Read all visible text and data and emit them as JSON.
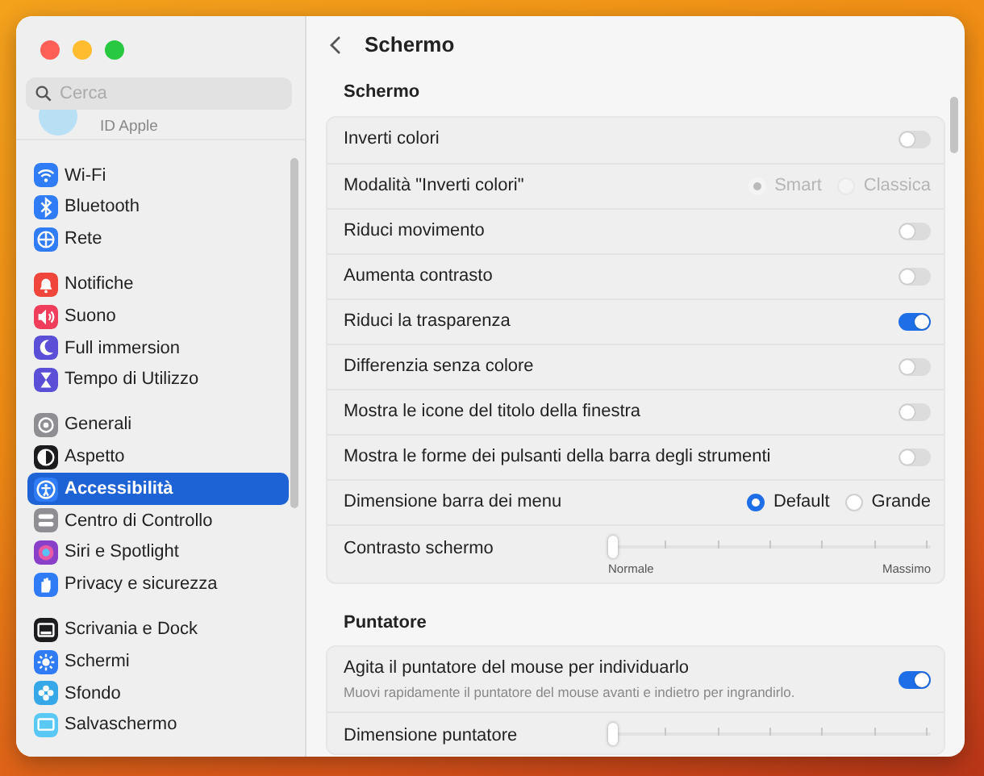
{
  "window": {
    "title": "Schermo"
  },
  "search": {
    "placeholder": "Cerca"
  },
  "account": {
    "label": "ID Apple"
  },
  "sidebar": {
    "groups": [
      [
        {
          "label": "Wi-Fi",
          "kind": "wifi",
          "color": "#2f7cf6",
          "selected": false
        },
        {
          "label": "Bluetooth",
          "kind": "bluetooth",
          "color": "#2f7cf6",
          "selected": false
        },
        {
          "label": "Rete",
          "kind": "globe",
          "color": "#2f7cf6",
          "selected": false
        }
      ],
      [
        {
          "label": "Notifiche",
          "kind": "bell",
          "color": "#f0453a",
          "selected": false
        },
        {
          "label": "Suono",
          "kind": "speaker",
          "color": "#ef3d5b",
          "selected": false
        },
        {
          "label": "Full immersion",
          "kind": "moon",
          "color": "#5a4fd6",
          "selected": false
        },
        {
          "label": "Tempo di Utilizzo",
          "kind": "hourglass",
          "color": "#5a4fd6",
          "selected": false
        }
      ],
      [
        {
          "label": "Generali",
          "kind": "gear",
          "color": "#8e8e93",
          "selected": false
        },
        {
          "label": "Aspetto",
          "kind": "contrast",
          "color": "#1c1c1e",
          "selected": false
        },
        {
          "label": "Accessibilità",
          "kind": "person",
          "color": "#2f7cf6",
          "selected": true
        },
        {
          "label": "Centro di Controllo",
          "kind": "switches",
          "color": "#8e8e93",
          "selected": false
        },
        {
          "label": "Siri e Spotlight",
          "kind": "orb",
          "color": "#8a3fc9",
          "selected": false
        },
        {
          "label": "Privacy e sicurezza",
          "kind": "hand",
          "color": "#2f7cf6",
          "selected": false
        }
      ],
      [
        {
          "label": "Scrivania e Dock",
          "kind": "dock",
          "color": "#1c1c1e",
          "selected": false
        },
        {
          "label": "Schermi",
          "kind": "sun",
          "color": "#2f7cf6",
          "selected": false
        },
        {
          "label": "Sfondo",
          "kind": "flower",
          "color": "#36a8e8",
          "selected": false
        },
        {
          "label": "Salvaschermo",
          "kind": "monitor",
          "color": "#5ac8f5",
          "selected": false
        }
      ]
    ]
  },
  "sections": [
    {
      "title": "Schermo",
      "rows": [
        {
          "kind": "toggle",
          "label": "Inverti colori",
          "on": false
        },
        {
          "kind": "radio",
          "label": "Modalità \"Inverti colori\"",
          "disabled": true,
          "options": [
            {
              "label": "Smart",
              "selected": true
            },
            {
              "label": "Classica",
              "selected": false
            }
          ]
        },
        {
          "kind": "toggle",
          "label": "Riduci movimento",
          "on": false
        },
        {
          "kind": "toggle",
          "label": "Aumenta contrasto",
          "on": false
        },
        {
          "kind": "toggle",
          "label": "Riduci la trasparenza",
          "on": true
        },
        {
          "kind": "toggle",
          "label": "Differenzia senza colore",
          "on": false
        },
        {
          "kind": "toggle",
          "label": "Mostra le icone del titolo della finestra",
          "on": false
        },
        {
          "kind": "toggle",
          "label": "Mostra le forme dei pulsanti della barra degli strumenti",
          "on": false
        },
        {
          "kind": "radio",
          "label": "Dimensione barra dei menu",
          "disabled": false,
          "options": [
            {
              "label": "Default",
              "selected": true
            },
            {
              "label": "Grande",
              "selected": false
            }
          ]
        },
        {
          "kind": "slider",
          "label": "Contrasto schermo",
          "level": 0,
          "min_label": "Normale",
          "max_label": "Massimo"
        }
      ]
    },
    {
      "title": "Puntatore",
      "rows": [
        {
          "kind": "toggle",
          "label": "Agita il puntatore del mouse per individuarlo",
          "description": "Muovi rapidamente il puntatore del mouse avanti e indietro per ingrandirlo.",
          "on": true
        },
        {
          "kind": "slider",
          "label": "Dimensione puntatore",
          "level": 0
        }
      ]
    }
  ]
}
